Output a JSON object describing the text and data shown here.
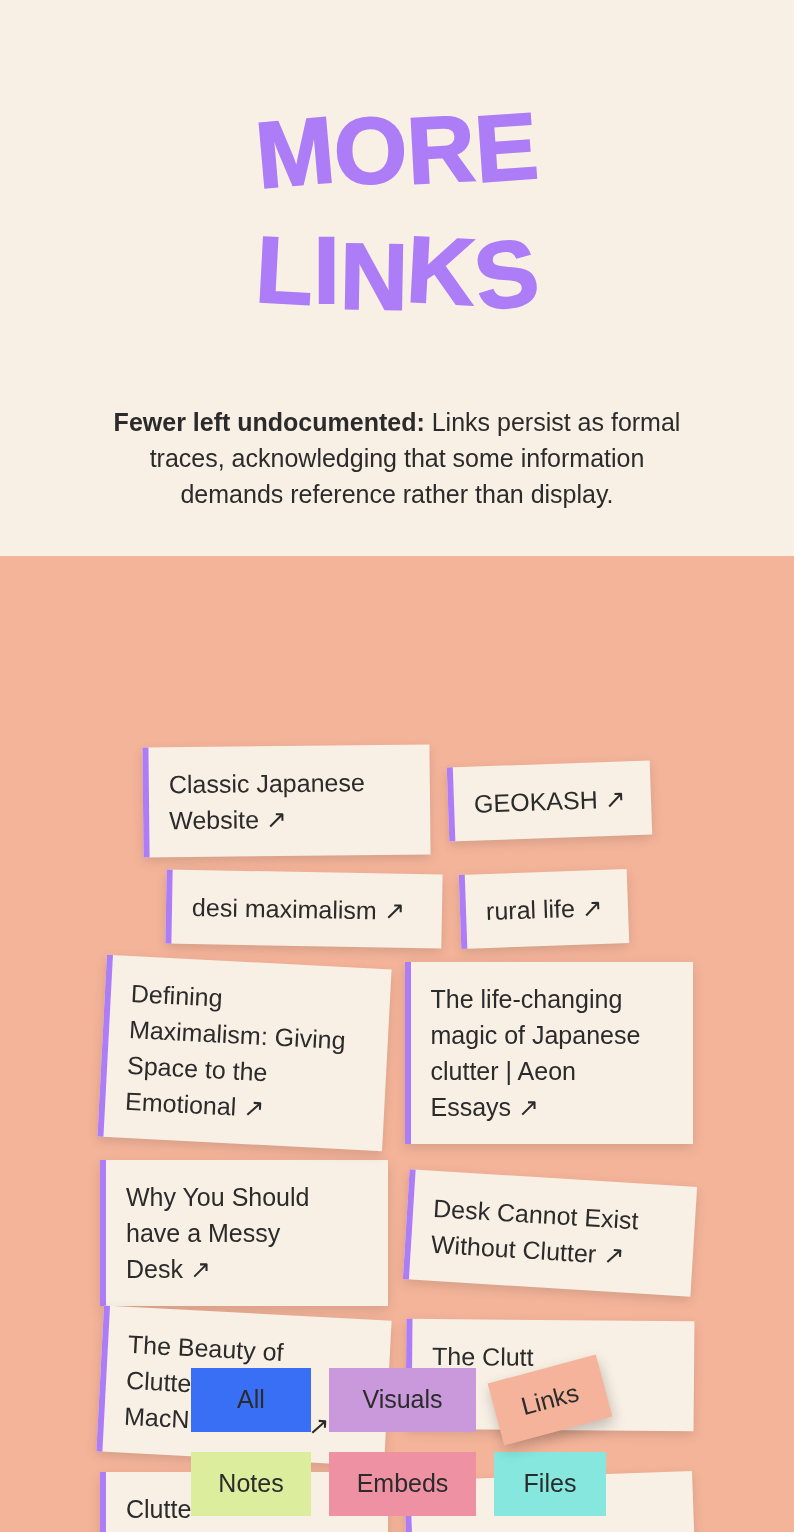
{
  "header": {
    "title_lines": [
      "MORE",
      "LINKS"
    ],
    "intro": "**Fewer left undocumented:** Links persist as formal traces, acknowledging that some information demands reference rather than display."
  },
  "links": [
    {
      "kind": "full",
      "lines": [
        "Classic Japanese",
        "Website ↗"
      ]
    },
    {
      "kind": "full",
      "lines": [
        "GEOKASH ↗"
      ]
    },
    {
      "kind": "full",
      "lines": [
        "desi maximalism ↗"
      ]
    },
    {
      "kind": "full",
      "lines": [
        "rural life ↗"
      ]
    },
    {
      "kind": "full",
      "lines": [
        "Defining",
        "Maximalism: Giving",
        "Space to the",
        "Emotional ↗"
      ]
    },
    {
      "kind": "full",
      "lines": [
        "The life-changing",
        "magic of Japanese",
        "clutter | Aeon",
        "Essays ↗"
      ]
    },
    {
      "kind": "full",
      "lines": [
        "Why You Should",
        "have a Messy",
        "Desk ↗"
      ]
    },
    {
      "kind": "full",
      "lines": [
        "Desk Cannot Exist",
        "Without Clutter ↗"
      ]
    },
    {
      "kind": "partly_hidden",
      "lines": [
        [
          "The Beauty of"
        ],
        [
          "Clutte"
        ],
        [
          "MacN",
          "↗"
        ]
      ]
    },
    {
      "kind": "partly_hidden",
      "lines": [
        [
          "The Clutt"
        ]
      ]
    },
    {
      "kind": "partly_hidden",
      "lines": [
        [
          "Clutte"
        ]
      ]
    },
    {
      "kind": "text_hidden"
    }
  ],
  "filters": [
    {
      "label": "All",
      "color": "#386ff4",
      "selected": false
    },
    {
      "label": "Visuals",
      "color": "#c999db",
      "selected": false
    },
    {
      "label": "Links",
      "color": "#f4b39a",
      "selected": true
    },
    {
      "label": "Notes",
      "color": "#dcee9e",
      "selected": false
    },
    {
      "label": "Embeds",
      "color": "#ee92a3",
      "selected": false
    },
    {
      "label": "Files",
      "color": "#85e7dd",
      "selected": false
    }
  ]
}
